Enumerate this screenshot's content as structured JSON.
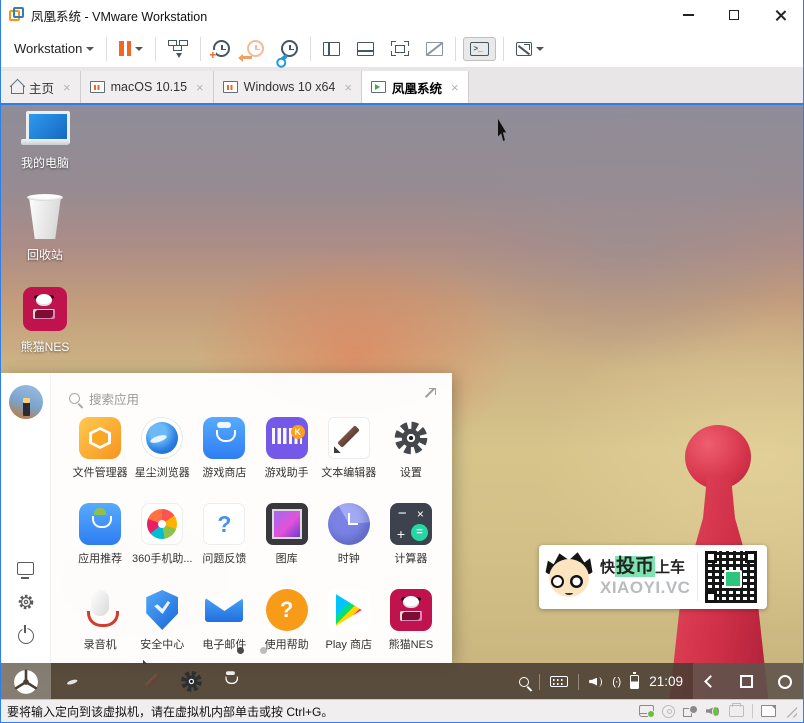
{
  "window": {
    "title": "凤凰系统 - VMware Workstation"
  },
  "toolbar": {
    "workstation_label": "Workstation"
  },
  "tabs": [
    {
      "label": "主页",
      "type": "home"
    },
    {
      "label": "macOS 10.15",
      "type": "vm",
      "state": "paused"
    },
    {
      "label": "Windows 10 x64",
      "type": "vm",
      "state": "paused"
    },
    {
      "label": "凤凰系统",
      "type": "vm",
      "state": "running",
      "active": true
    }
  ],
  "desktop": {
    "icons": [
      {
        "label": "我的电脑"
      },
      {
        "label": "回收站"
      },
      {
        "label": "熊猫NES"
      }
    ]
  },
  "launcher": {
    "search_placeholder": "搜索应用",
    "apps": [
      {
        "label": "文件管理器"
      },
      {
        "label": "星尘浏览器"
      },
      {
        "label": "游戏商店"
      },
      {
        "label": "游戏助手",
        "badge": "K"
      },
      {
        "label": "文本编辑器"
      },
      {
        "label": "设置"
      },
      {
        "label": "应用推荐"
      },
      {
        "label": "360手机助..."
      },
      {
        "label": "问题反馈",
        "glyph": "?"
      },
      {
        "label": "图库"
      },
      {
        "label": "时钟"
      },
      {
        "label": "计算器",
        "glyph_minus": "−",
        "glyph_mul": "×",
        "glyph_plus": "+",
        "glyph_eq": "="
      },
      {
        "label": "录音机"
      },
      {
        "label": "安全中心"
      },
      {
        "label": "电子邮件"
      },
      {
        "label": "使用帮助",
        "glyph": "?"
      },
      {
        "label": "Play 商店"
      },
      {
        "label": "熊猫NES"
      }
    ],
    "pages": 2,
    "active_page": 1
  },
  "watermark": {
    "tagline_prefix": "快",
    "tagline_highlight": "投币",
    "tagline_suffix": "上车",
    "site": "XIAOYI.VC"
  },
  "taskbar": {
    "time": "21:09"
  },
  "status_bar": {
    "message": "要将输入定向到该虚拟机，请在虚拟机内部单击或按 Ctrl+G。"
  },
  "colors": {
    "vmware_orange": "#f26722",
    "snapshot_blue": "#1f9ad6",
    "tab_bar_bg": "#e8e6e7",
    "taskbar_bg": "#493d33",
    "watermark_highlight": "#7ce3b1",
    "panda_nes_red": "#c0134e",
    "status_green_dot": "#6fbf3f"
  }
}
